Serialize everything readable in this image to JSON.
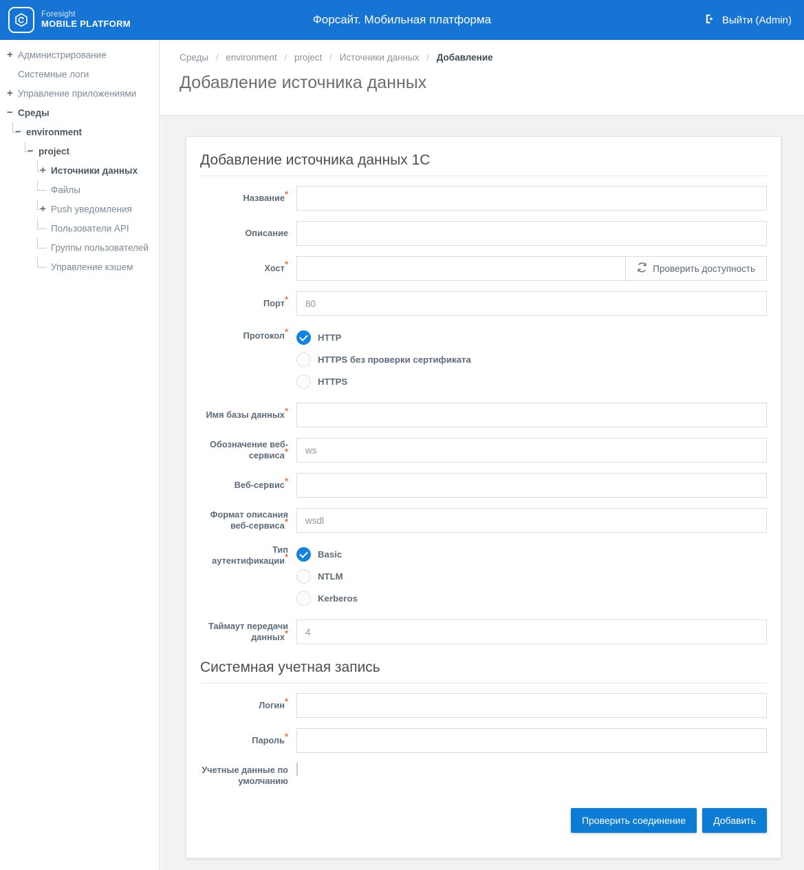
{
  "header": {
    "logo_line1": "Foresight",
    "logo_line2": "MOBILE PLATFORM",
    "app_title": "Форсайт. Мобильная платформа",
    "logout_label": "Выйти (Admin)",
    "bar_color": "#1574d4"
  },
  "sidebar": {
    "items": [
      {
        "label": "Администрирование",
        "toggle": "+",
        "level": 0,
        "bold": false
      },
      {
        "label": "Системные логи",
        "toggle": "",
        "level": 0,
        "bold": false
      },
      {
        "label": "Управление приложениями",
        "toggle": "+",
        "level": 0,
        "bold": false
      },
      {
        "label": "Среды",
        "toggle": "−",
        "level": 0,
        "bold": true
      },
      {
        "label": "environment",
        "toggle": "−",
        "level": 1,
        "bold": true
      },
      {
        "label": "project",
        "toggle": "−",
        "level": 2,
        "bold": true
      },
      {
        "label": "Источники данных",
        "toggle": "+",
        "level": 3,
        "bold": true
      },
      {
        "label": "Файлы",
        "toggle": "",
        "level": 3,
        "bold": false
      },
      {
        "label": "Push уведомления",
        "toggle": "+",
        "level": 3,
        "bold": false
      },
      {
        "label": "Пользователи API",
        "toggle": "",
        "level": 3,
        "bold": false
      },
      {
        "label": "Группы пользователей",
        "toggle": "",
        "level": 3,
        "bold": false
      },
      {
        "label": "Управление кэшем",
        "toggle": "",
        "level": 3,
        "bold": false
      }
    ]
  },
  "breadcrumb": {
    "items": [
      "Среды",
      "environment",
      "project",
      "Источники данных",
      "Добавление"
    ],
    "separator": "/"
  },
  "page": {
    "title": "Добавление источника данных"
  },
  "form": {
    "section1_title": "Добавление источника данных 1С",
    "section2_title": "Системная учетная запись",
    "required_mark": "*",
    "fields": {
      "name_label": "Название",
      "name_value": "",
      "description_label": "Описание",
      "description_value": "",
      "host_label": "Хост",
      "host_value": "",
      "check_availability_label": "Проверить доступность",
      "port_label": "Порт",
      "port_value": "80",
      "protocol_label": "Протокол",
      "db_name_label": "Имя базы данных",
      "db_name_value": "",
      "ws_alias_label": "Обозначение веб-сервиса",
      "ws_alias_value": "ws",
      "web_service_label": "Веб-сервис",
      "web_service_value": "",
      "ws_format_label": "Формат описания веб-сервиса",
      "ws_format_value": "wsdl",
      "auth_type_label": "Тип аутентификации",
      "timeout_label": "Таймаут передачи данных",
      "timeout_value": "4",
      "login_label": "Логин",
      "login_value": "",
      "password_label": "Пароль",
      "password_value": "",
      "default_creds_label": "Учетные данные по умолчанию",
      "default_creds_checked": false
    },
    "protocol_options": [
      {
        "label": "HTTP",
        "selected": true
      },
      {
        "label": "HTTPS без проверки сертификата",
        "selected": false
      },
      {
        "label": "HTTPS",
        "selected": false
      }
    ],
    "auth_options": [
      {
        "label": "Basic",
        "selected": true
      },
      {
        "label": "NTLM",
        "selected": false
      },
      {
        "label": "Kerberos",
        "selected": false
      }
    ],
    "buttons": {
      "test_connection": "Проверить соединение",
      "add": "Добавить"
    },
    "accent_color": "#0c7cd5",
    "required_color": "#e8743b"
  }
}
